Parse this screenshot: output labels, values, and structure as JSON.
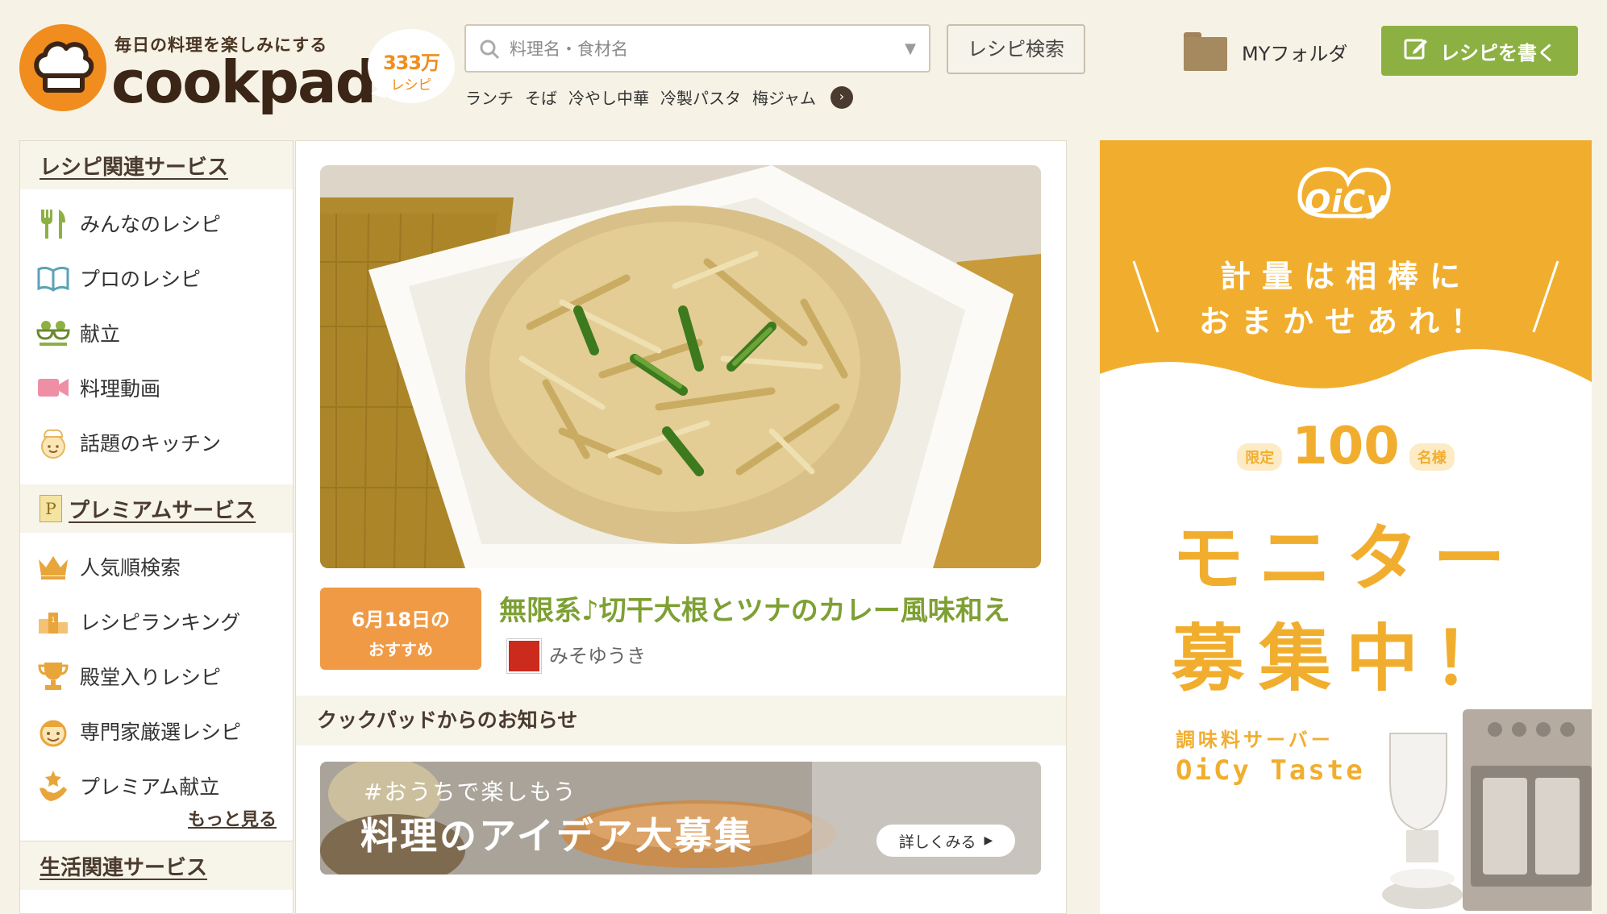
{
  "header": {
    "tagline": "毎日の料理を楽しみにする",
    "logo_text": "cookpad",
    "recipe_count": "333万",
    "recipe_count_unit": "レシピ",
    "search_placeholder": "料理名・食材名",
    "search_button": "レシピ検索",
    "keywords": [
      "ランチ",
      "そば",
      "冷やし中華",
      "冷製パスタ",
      "梅ジャム"
    ],
    "my_folder": "MYフォルダ",
    "write_button": "レシピを書く"
  },
  "sidebar": {
    "recipe_services_title": "レシピ関連サービス",
    "recipe_services": [
      {
        "label": "みんなのレシピ",
        "icon": "fork-knife-icon"
      },
      {
        "label": "プロのレシピ",
        "icon": "open-book-icon"
      },
      {
        "label": "献立",
        "icon": "bowls-icon"
      },
      {
        "label": "料理動画",
        "icon": "video-camera-icon"
      },
      {
        "label": "話題のキッチン",
        "icon": "chef-face-icon"
      }
    ],
    "premium_badge": "P",
    "premium_title": "プレミアムサービス",
    "premium_services": [
      {
        "label": "人気順検索",
        "icon": "crown-icon"
      },
      {
        "label": "レシピランキング",
        "icon": "podium-icon"
      },
      {
        "label": "殿堂入りレシピ",
        "icon": "trophy-icon"
      },
      {
        "label": "専門家厳選レシピ",
        "icon": "expert-face-icon"
      },
      {
        "label": "プレミアム献立",
        "icon": "star-hand-icon"
      }
    ],
    "more_link": "もっと見る",
    "life_services_title": "生活関連サービス"
  },
  "main": {
    "pick_date": "6月18日の",
    "pick_label": "おすすめ",
    "pick_title": "無限系♪切干大根とツナのカレー風味和え",
    "author": "みそゆうき",
    "notice_title": "クックパッドからのお知らせ",
    "banner_hashtag": "#おうちで楽しもう",
    "banner_title": "料理のアイデア大募集",
    "banner_button": "詳しくみる"
  },
  "ad": {
    "brand": "OiCy",
    "headline1": "計量は相棒に",
    "headline2": "おまかせあれ！",
    "limited": "限定",
    "limited_count": "100",
    "limited_suffix": "名様",
    "monitor": "モニター",
    "recruiting": "募集中！",
    "product_label": "調味料サーバー",
    "product_name": "OiCy Taste"
  },
  "colors": {
    "background": "#f6f2e6",
    "brand_orange": "#f08d1e",
    "write_green": "#8db043",
    "title_green": "#7ea033",
    "ad_yellow": "#f1ae2e"
  }
}
